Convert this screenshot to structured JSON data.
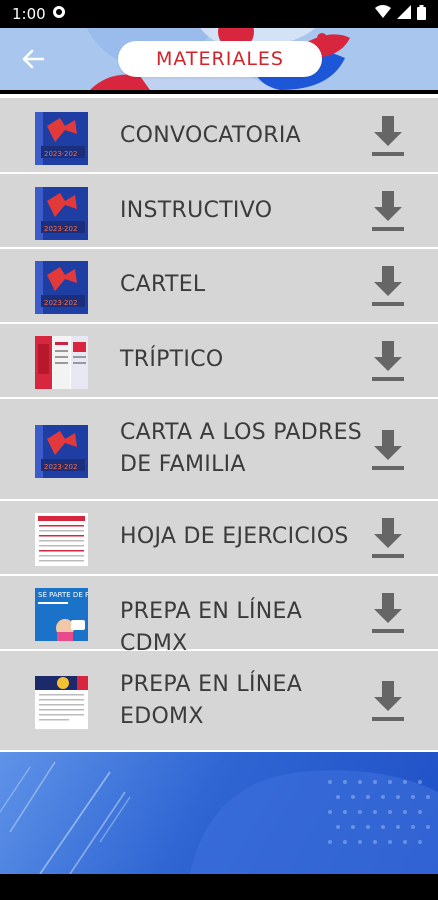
{
  "status_bar": {
    "time": "1:00"
  },
  "header": {
    "title": "MATERIALES"
  },
  "items": [
    {
      "label": "CONVOCATORIA",
      "thumb": "poster"
    },
    {
      "label": "INSTRUCTIVO",
      "thumb": "poster"
    },
    {
      "label": "CARTEL",
      "thumb": "poster"
    },
    {
      "label": "TRÍPTICO",
      "thumb": "triptych"
    },
    {
      "label": "CARTA A LOS PADRES DE FAMILIA",
      "thumb": "poster"
    },
    {
      "label": "HOJA DE EJERCICIOS",
      "thumb": "document"
    },
    {
      "label": "PREPA EN LÍNEA CDMX",
      "thumb": "cdmx"
    },
    {
      "label": "PREPA EN LÍNEA EDOMX",
      "thumb": "edomx"
    }
  ],
  "cdmx_thumb_text": "SÉ PARTE DE PREPA EN LÍNEA",
  "colors": {
    "accent_red": "#d1232a",
    "header_bg": "#a9c6ee",
    "list_bg": "#d6d6d6",
    "banner_blue": "#2f66d3"
  }
}
